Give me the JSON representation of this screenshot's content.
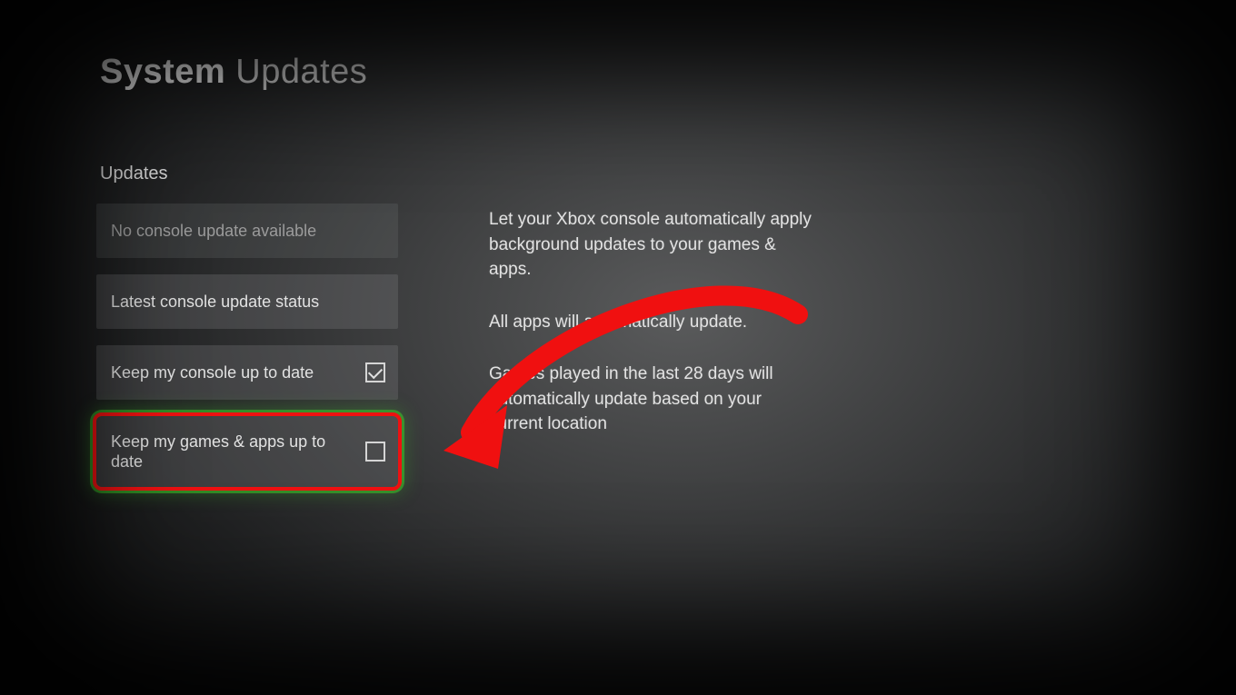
{
  "title": {
    "bold": "System",
    "light": "Updates"
  },
  "section_label": "Updates",
  "options": {
    "no_update": "No console update available",
    "latest_status": "Latest console update status",
    "keep_console": "Keep my console up to date",
    "keep_games": "Keep my games & apps up to date"
  },
  "description": {
    "p1": "Let your Xbox console automatically apply background updates to your games & apps.",
    "p2": "All apps will automatically update.",
    "p3": "Games played in the last 28 days will automatically update based on your current location"
  },
  "checkbox_state": {
    "keep_console": true,
    "keep_games": false
  },
  "annotation": {
    "arrow_color": "#f01010"
  }
}
